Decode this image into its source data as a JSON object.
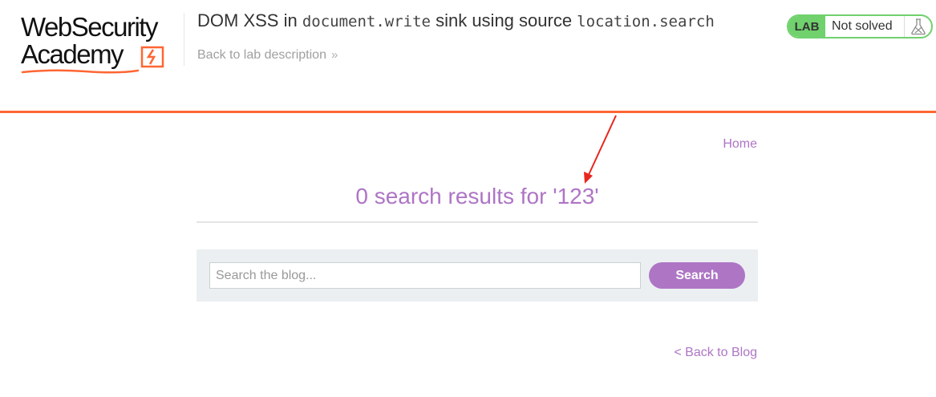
{
  "header": {
    "logo": {
      "line1": "WebSecurity",
      "line2": "Academy"
    },
    "title_parts": [
      {
        "text": "DOM XSS in ",
        "code": false
      },
      {
        "text": "document.write",
        "code": true
      },
      {
        "text": " sink using source ",
        "code": false
      },
      {
        "text": "location.search",
        "code": true
      }
    ],
    "back_to_lab": "Back to lab description",
    "status": {
      "badge": "LAB",
      "text": "Not solved",
      "icon": "flask-icon"
    }
  },
  "nav": {
    "home": "Home"
  },
  "results": {
    "heading": "0 search results for '123'"
  },
  "search": {
    "placeholder": "Search the blog...",
    "value": "",
    "button": "Search"
  },
  "footer": {
    "back_to_blog": "< Back to Blog"
  },
  "colors": {
    "accent_orange": "#ff6633",
    "link_purple": "#ae75c5",
    "status_green": "#70d16d",
    "panel_bg": "#ebeff2",
    "annotation_red": "#e8251f"
  }
}
